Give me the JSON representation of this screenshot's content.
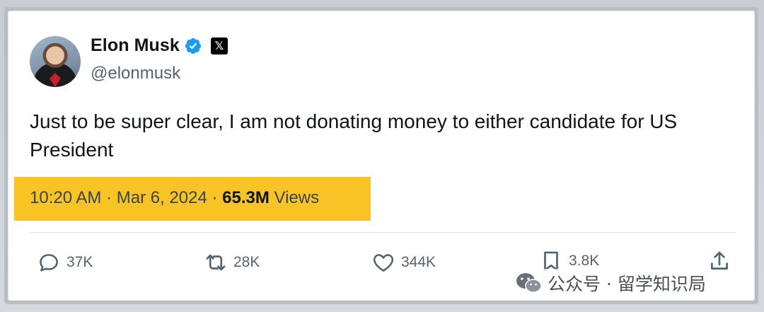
{
  "tweet": {
    "author_name": "Elon Musk",
    "author_handle": "@elonmusk",
    "text": "Just to be super clear, I am not donating money to either candidate for US President",
    "time": "10:20 AM",
    "date": "Mar 6, 2024",
    "separator": "·",
    "views_count": "65.3M",
    "views_label": "Views",
    "icons": {
      "verified": "verified-badge-icon",
      "affiliation": "x-logo-icon"
    }
  },
  "actions": {
    "reply_count": "37K",
    "retweet_count": "28K",
    "like_count": "344K",
    "bookmark_count": "3.8K"
  },
  "watermark": {
    "text": "公众号 · 留学知识局"
  },
  "colors": {
    "highlight": "#f7c325",
    "verified_blue": "#1d9bf0",
    "text_primary": "#0f1419",
    "text_secondary": "#536471"
  }
}
